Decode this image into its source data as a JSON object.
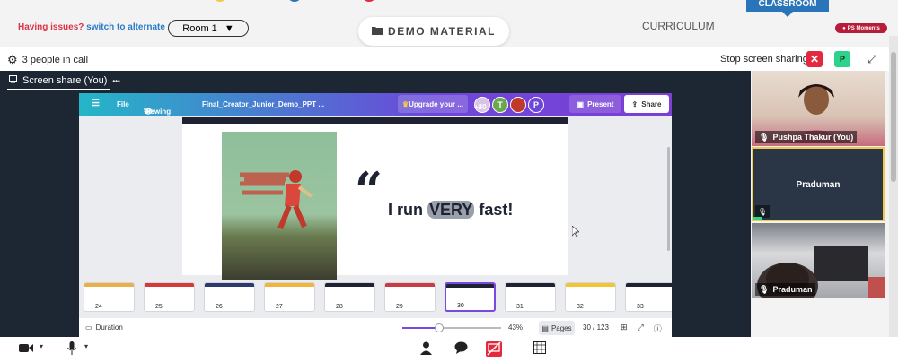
{
  "topbar": {
    "issues_label": "Having issues?",
    "switch_label": "switch to alternate room",
    "room_value": "Room 1",
    "demo_material": "DEMO MATERIAL",
    "curriculum": "CURRICULUM",
    "classroom_tab": "CLASSROOM",
    "moments_badge": "PS Moments"
  },
  "callbar": {
    "people_count": "3 people in call",
    "stop_sharing": "Stop screen sharing",
    "stop_icon": "✕",
    "p_button": "P",
    "expand_icon": "⤢"
  },
  "stage": {
    "screen_share_label": "Screen share (You)",
    "more_icon": "•••"
  },
  "canva": {
    "menu_icon": "☰",
    "file_menu": "File",
    "viewing_label": "Viewing",
    "doc_title": "Final_Creator_Junior_Demo_PPT ...",
    "upgrade_label": "Upgrade your ...",
    "collab_count": "+30",
    "collab_t": "T",
    "collab_p": "P",
    "add_collab": "+",
    "present_label": "Present",
    "share_label": "Share",
    "slide": {
      "quote_mark": "“",
      "text_before": "I run ",
      "text_highlight": "VERY",
      "text_after": " fast!"
    },
    "thumbnails": [
      {
        "num": "24",
        "color": "#e7b04a"
      },
      {
        "num": "25",
        "color": "#d33a3a"
      },
      {
        "num": "26",
        "color": "#2e3a6e"
      },
      {
        "num": "27",
        "color": "#f1b43c"
      },
      {
        "num": "28",
        "color": "#1e2233"
      },
      {
        "num": "29",
        "color": "#c93c46"
      },
      {
        "num": "30",
        "color": "#1e2233"
      },
      {
        "num": "31",
        "color": "#1e2233"
      },
      {
        "num": "32",
        "color": "#f2c437"
      },
      {
        "num": "33",
        "color": "#1e2233"
      }
    ],
    "duration_label": "Duration",
    "zoom_pct": "43%",
    "pages_label": "Pages",
    "page_count": "30 / 123"
  },
  "participants": {
    "p1_name": "Pushpa Thakur (You)",
    "p2_name": "Praduman",
    "p3_name": "Praduman"
  },
  "colors": {
    "brand_blue": "#2a74b9",
    "alert_red": "#e4283e",
    "canva_purple": "#7a4ae0",
    "active_speaker": "#f2c94c"
  }
}
